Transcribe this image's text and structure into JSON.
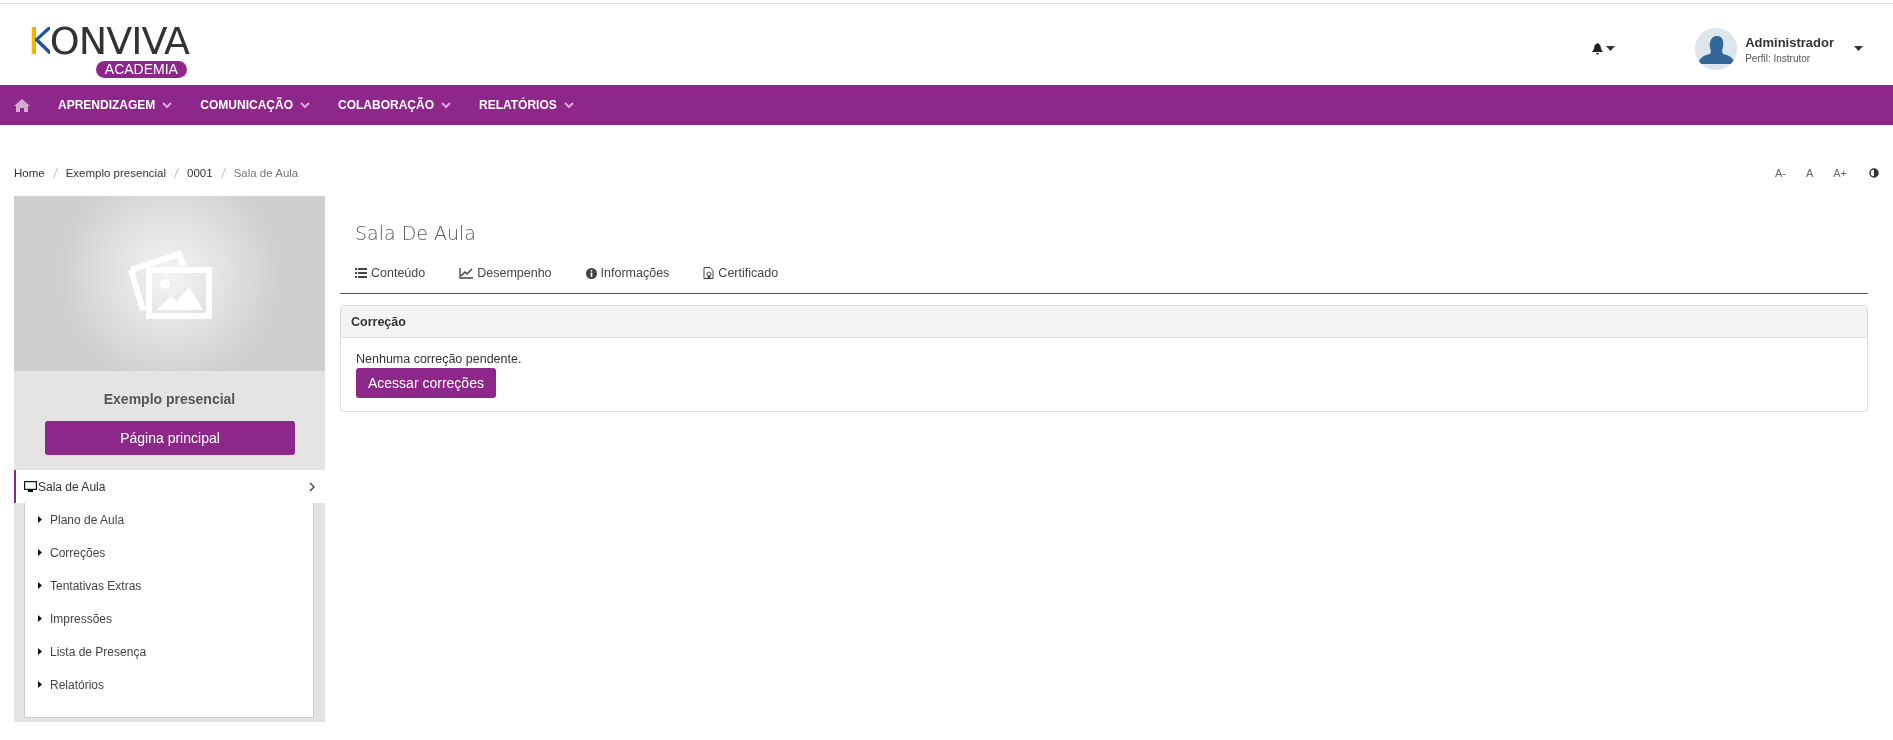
{
  "header": {
    "logo": {
      "text": "KONVIVA",
      "badge": "ACADEMIA"
    },
    "user": {
      "name": "Administrador",
      "role": "Perfil: Instrutor"
    }
  },
  "nav": {
    "items": [
      {
        "label": "APRENDIZAGEM"
      },
      {
        "label": "COMUNICAÇÃO"
      },
      {
        "label": "COLABORAÇÃO"
      },
      {
        "label": "RELATÓRIOS"
      }
    ]
  },
  "breadcrumb": [
    {
      "label": "Home",
      "current": false
    },
    {
      "label": "Exemplo presencial",
      "current": false
    },
    {
      "label": "0001",
      "current": false
    },
    {
      "label": "Sala de Aula",
      "current": true
    }
  ],
  "font_controls": [
    "A-",
    "A",
    "A+"
  ],
  "course": {
    "title": "Exemplo presencial",
    "button": "Página principal",
    "menu": {
      "label": "Sala de Aula",
      "expanded": true,
      "children": [
        {
          "label": "Plano de Aula"
        },
        {
          "label": "Correções"
        },
        {
          "label": "Tentativas Extras"
        },
        {
          "label": "Impressões"
        },
        {
          "label": "Lista de Presença"
        },
        {
          "label": "Relatórios"
        }
      ]
    }
  },
  "page": {
    "title": "Sala De Aula",
    "tabs": [
      {
        "label": "Conteúdo"
      },
      {
        "label": "Desempenho"
      },
      {
        "label": "Informações"
      },
      {
        "label": "Certificado"
      }
    ],
    "panel": {
      "title": "Correção",
      "message": "Nenhuma correção pendente.",
      "button": "Acessar correções"
    }
  }
}
